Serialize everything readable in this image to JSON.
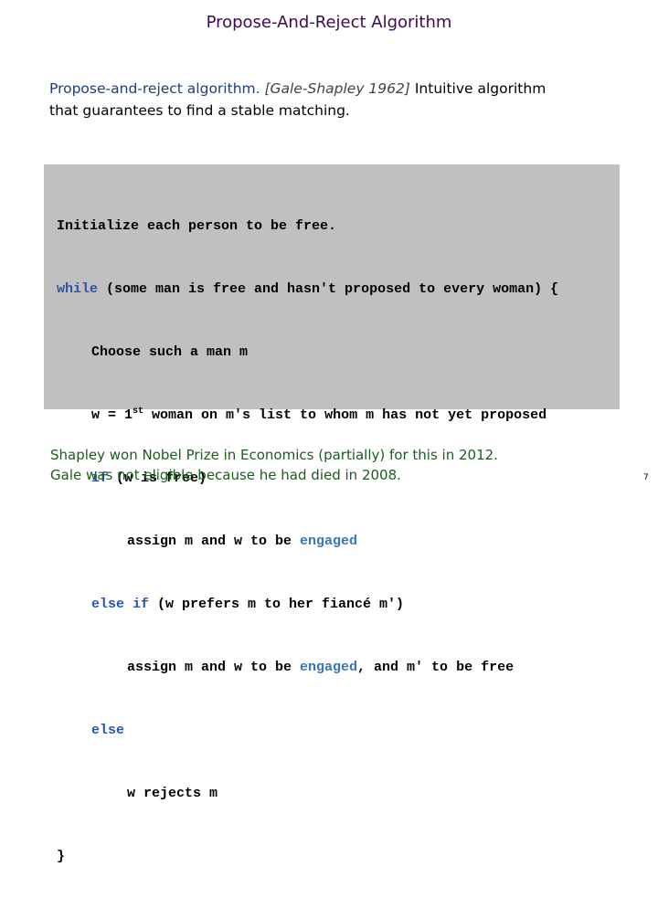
{
  "slide": {
    "title": "Propose-And-Reject Algorithm",
    "page_number": "7"
  },
  "intro": {
    "name": "Propose-and-reject algorithm.",
    "citation": "[Gale-Shapley 1962]",
    "text_line1": "Intuitive algorithm",
    "text_line2": "that guarantees to find a stable matching."
  },
  "code": {
    "line1": "Initialize each person to be free.",
    "line2_kw": "while",
    "line2_rest": " (some man is free and hasn't proposed to every woman) {",
    "line3": "Choose such a man m",
    "line4_pre": "w = 1",
    "line4_sup": "st",
    "line4_post": " woman on m's list to whom m has not yet proposed",
    "line5_kw": "if",
    "line5_rest": " (w is free)",
    "line6_pre": "assign m and w to be ",
    "line6_hl": "engaged",
    "line7_kw": "else if",
    "line7_rest": " (w prefers m to her fiancé m')",
    "line8_pre": "assign m and w to be ",
    "line8_hl": "engaged",
    "line8_post": ", and m' to be free",
    "line9_kw": "else",
    "line10": "w rejects m",
    "line11": "}"
  },
  "footer": {
    "line1": "Shapley won Nobel Prize in Economics (partially) for this in 2012.",
    "line2": "Gale was not eligible because he had died in 2008."
  },
  "colors": {
    "title": "#3b0a4f",
    "intro_name": "#1f3d7a",
    "code_background": "#c0c0c0",
    "keyword": "#2a55a8",
    "highlight": "#3377bb",
    "footer": "#1d5c1d"
  }
}
